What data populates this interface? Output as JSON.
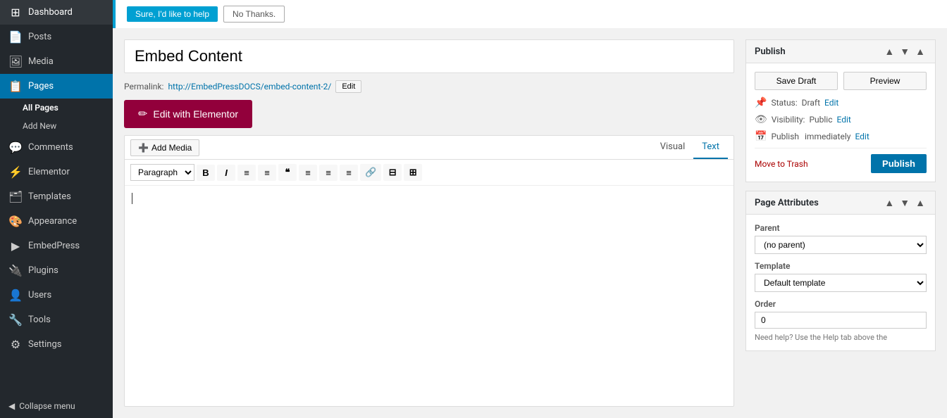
{
  "sidebar": {
    "items": [
      {
        "id": "dashboard",
        "label": "Dashboard",
        "icon": "⊞"
      },
      {
        "id": "posts",
        "label": "Posts",
        "icon": "📄"
      },
      {
        "id": "media",
        "label": "Media",
        "icon": "🖼"
      },
      {
        "id": "pages",
        "label": "Pages",
        "icon": "📋",
        "active": true
      },
      {
        "id": "comments",
        "label": "Comments",
        "icon": "💬"
      },
      {
        "id": "elementor",
        "label": "Elementor",
        "icon": "⚡"
      },
      {
        "id": "templates",
        "label": "Templates",
        "icon": "🗂"
      },
      {
        "id": "appearance",
        "label": "Appearance",
        "icon": "🎨"
      },
      {
        "id": "embedpress",
        "label": "EmbedPress",
        "icon": "▶"
      },
      {
        "id": "plugins",
        "label": "Plugins",
        "icon": "🔌"
      },
      {
        "id": "users",
        "label": "Users",
        "icon": "👤"
      },
      {
        "id": "tools",
        "label": "Tools",
        "icon": "🔧"
      },
      {
        "id": "settings",
        "label": "Settings",
        "icon": "⚙"
      }
    ],
    "sub_items": [
      {
        "id": "all-pages",
        "label": "All Pages",
        "active": true
      },
      {
        "id": "add-new",
        "label": "Add New",
        "active": false
      }
    ],
    "collapse_label": "Collapse menu"
  },
  "help_banner": {
    "yes_label": "Sure, I'd like to help",
    "no_label": "No Thanks."
  },
  "topbar": {
    "title": "Publish"
  },
  "editor": {
    "title_placeholder": "Embed Content",
    "title_value": "Embed Content",
    "permalink_label": "Permalink:",
    "permalink_url": "http://EmbedPressDOCS/embed-content-2/",
    "edit_label": "Edit",
    "elementor_btn_label": "Edit with Elementor",
    "tabs": [
      {
        "id": "visual",
        "label": "Visual",
        "active": false
      },
      {
        "id": "text",
        "label": "Text",
        "active": true
      }
    ],
    "add_media_label": "Add Media",
    "toolbar": {
      "format_select": "Paragraph",
      "buttons": [
        "B",
        "I",
        "≡",
        "≡",
        "❝",
        "≡",
        "≡",
        "≡",
        "🔗",
        "⊟",
        "⊞"
      ]
    }
  },
  "publish_panel": {
    "title": "Publish",
    "save_draft_label": "Save Draft",
    "preview_label": "Preview",
    "status_label": "Status:",
    "status_value": "Draft",
    "status_edit": "Edit",
    "visibility_label": "Visibility:",
    "visibility_value": "Public",
    "visibility_edit": "Edit",
    "publish_time_label": "Publish",
    "publish_time_value": "immediately",
    "publish_time_edit": "Edit",
    "move_trash_label": "Move to Trash",
    "publish_btn_label": "Publish"
  },
  "page_attributes_panel": {
    "title": "Page Attributes",
    "parent_label": "Parent",
    "parent_options": [
      "(no parent)"
    ],
    "parent_selected": "(no parent)",
    "template_label": "Template",
    "template_options": [
      "Default template"
    ],
    "template_selected": "Default template",
    "order_label": "Order",
    "order_value": "0",
    "help_text": "Need help? Use the Help tab above the"
  }
}
